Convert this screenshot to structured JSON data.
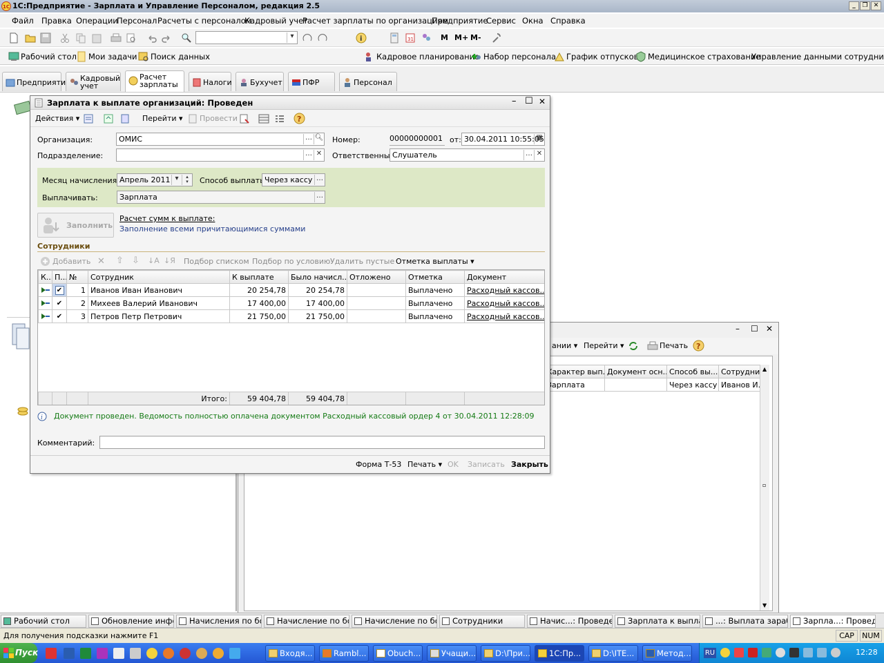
{
  "app": {
    "title": "1С:Предприятие - Зарплата и Управление Персоналом, редакция 2.5",
    "window_buttons": [
      "_",
      "❐",
      "✕"
    ]
  },
  "menu": [
    "Файл",
    "Правка",
    "Операции",
    "Персонал",
    "Расчеты с персоналом",
    "Кадровый учет",
    "Расчет зарплаты по организациям",
    "Предприятие",
    "Сервис",
    "Окна",
    "Справка"
  ],
  "toolbar": {
    "search_value": "",
    "m_buttons": [
      "M",
      "M+",
      "M-"
    ]
  },
  "quicklinks": [
    "Рабочий стол",
    "Мои задачи",
    "Поиск данных",
    "Кадровое планирование",
    "Набор персонала",
    "График отпусков",
    "Медицинское страхование",
    "Управление данными сотрудника"
  ],
  "section_tabs": [
    "Предприятие",
    "Кадровый учет",
    "Расчет зарплаты",
    "Налоги",
    "Бухучет",
    "ПФР",
    "Персонал"
  ],
  "doc": {
    "title": "Зарплата к выплате организаций: Проведен",
    "toolbar": {
      "actions": "Действия",
      "goto": "Перейти",
      "post": "Провести"
    },
    "org_label": "Организация:",
    "org_value": "ОМИС",
    "number_label": "Номер:",
    "number_value": "00000000001",
    "from_label": "от:",
    "date_value": "30.04.2011 10:55:05",
    "dept_label": "Подразделение:",
    "dept_value": "",
    "resp_label": "Ответственный:",
    "resp_value": "Слушатель",
    "month_label": "Месяц начисления:",
    "month_value": "Апрель 2011",
    "paymethod_label": "Способ выплаты:",
    "paymethod_value": "Через кассу",
    "pay_label": "Выплачивать:",
    "pay_value": "Зарплата",
    "fill_button": "Заполнить",
    "calc_link": "Расчет сумм к выплате:",
    "calc_desc": "Заполнение всеми причитающимися суммами",
    "employees_header": "Сотрудники",
    "emp_toolbar": {
      "add": "Добавить",
      "pick_list": "Подбор списком",
      "pick_cond": "Подбор по условию",
      "del_empty": "Удалить пустые",
      "mark": "Отметка выплаты"
    },
    "columns": [
      "К...",
      "П...",
      "№",
      "Сотрудник",
      "К выплате",
      "Было начисл...",
      "Отложено",
      "Отметка",
      "Документ"
    ],
    "rows": [
      {
        "n": "1",
        "name": "Иванов Иван Иванович",
        "pay": "20 254,78",
        "accrued": "20 254,78",
        "deferred": "",
        "mark": "Выплачено",
        "doc": "Расходный кассов..."
      },
      {
        "n": "2",
        "name": "Михеев Валерий Иванович",
        "pay": "17 400,00",
        "accrued": "17 400,00",
        "deferred": "",
        "mark": "Выплачено",
        "doc": "Расходный кассов..."
      },
      {
        "n": "3",
        "name": "Петров Петр Петрович",
        "pay": "21 750,00",
        "accrued": "21 750,00",
        "deferred": "",
        "mark": "Выплачено",
        "doc": "Расходный кассов..."
      }
    ],
    "total_label": "Итого:",
    "total_pay": "59 404,78",
    "total_accrued": "59 404,78",
    "info": "Документ проведен. Ведомость полностью оплачена документом Расходный кассовый ордер 4 от 30.04.2011 12:28:09",
    "comment_label": "Комментарий:",
    "comment_value": "",
    "footer": {
      "form": "Форма Т-53",
      "print": "Печать",
      "ok": "OK",
      "save": "Записать",
      "close": "Закрыть"
    }
  },
  "bgwin": {
    "toolbar": {
      "partial": "ании",
      "goto": "Перейти",
      "print": "Печать"
    },
    "columns": [
      "Характер вып...",
      "Документ осн...",
      "Способ вы...",
      "Сотрудник"
    ],
    "row": {
      "kind": "Зарплата",
      "doc": "",
      "method": "Через кассу",
      "emp": "Иванов И..."
    }
  },
  "window_tabs": [
    "Рабочий стол",
    "Обновление инфо...",
    "Начисления по бо...",
    "Начисление по бо...",
    "Начисление по бо...",
    "Сотрудники",
    "Начис...: Проведен *",
    "Зарплата к выпла...",
    "...: Выплата зараб...",
    "Зарпла...: Проведен"
  ],
  "status": {
    "hint": "Для получения подсказки нажмите F1",
    "cap": "CAP",
    "num": "NUM"
  },
  "taskbar": {
    "start": "Пуск",
    "items": [
      "Входя...",
      "Rambl...",
      "Obuch...",
      "Учащи...",
      "D:\\При...",
      "1С:Пр...",
      "D:\\ITE...",
      "Метод..."
    ],
    "lang": "RU",
    "clock": "12:28"
  }
}
